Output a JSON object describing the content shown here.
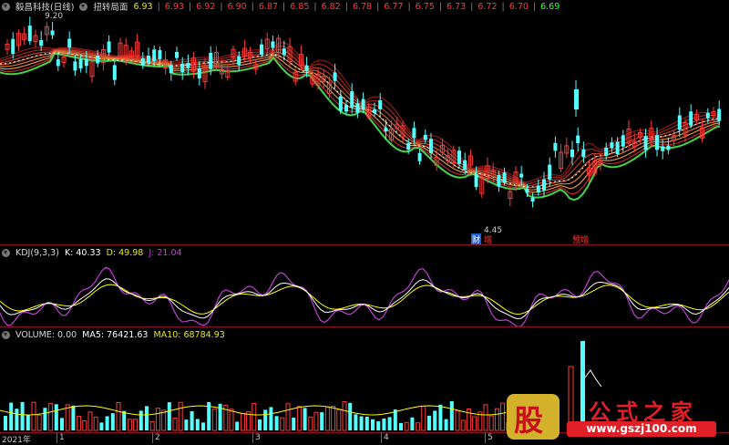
{
  "title_bar": {
    "stock_label": "毅昌科技(日线)",
    "indicator_label": "扭转局面",
    "values": [
      "6.93",
      "6.93",
      "6.92",
      "6.90",
      "6.87",
      "6.85",
      "6.82",
      "6.78",
      "6.77",
      "6.75",
      "6.73",
      "6.72",
      "6.70",
      "6.69"
    ],
    "colors": [
      "#e8e800",
      "#ff3a3a",
      "#ff3a3a",
      "#ff3a3a",
      "#ff3a3a",
      "#ff3a3a",
      "#ff3a3a",
      "#ff3a3a",
      "#ff3a3a",
      "#ff3a3a",
      "#ff3a3a",
      "#ff3a3a",
      "#ff3a3a",
      "#40ff40"
    ]
  },
  "price_pane": {
    "high_label": "9.20",
    "low_label": "4.45",
    "tag_finance": "财",
    "tag_increase": "增",
    "tag_earnings": "预增"
  },
  "kdj": {
    "name": "KDJ(9,3,3)",
    "k": "K: 40.33",
    "d": "D: 49.98",
    "j": "J: 21.04"
  },
  "volume": {
    "name": "VOLUME: 0.00",
    "ma5": "MA5: 76421.63",
    "ma10": "MA10: 68784.93"
  },
  "x_axis": [
    "2021年",
    "1",
    "2",
    "3",
    "4",
    "5"
  ],
  "watermark": {
    "logo": "股",
    "site": "公式之家",
    "url": "www.gszj100.com"
  },
  "colors": {
    "up": "#ff3a3a",
    "down": "#54ffff",
    "ma": "#ffff00",
    "green_band": "#44d44a",
    "kline": "#ffffff",
    "jline": "#c040d0",
    "grid_sep": "#8b0c2c"
  }
}
